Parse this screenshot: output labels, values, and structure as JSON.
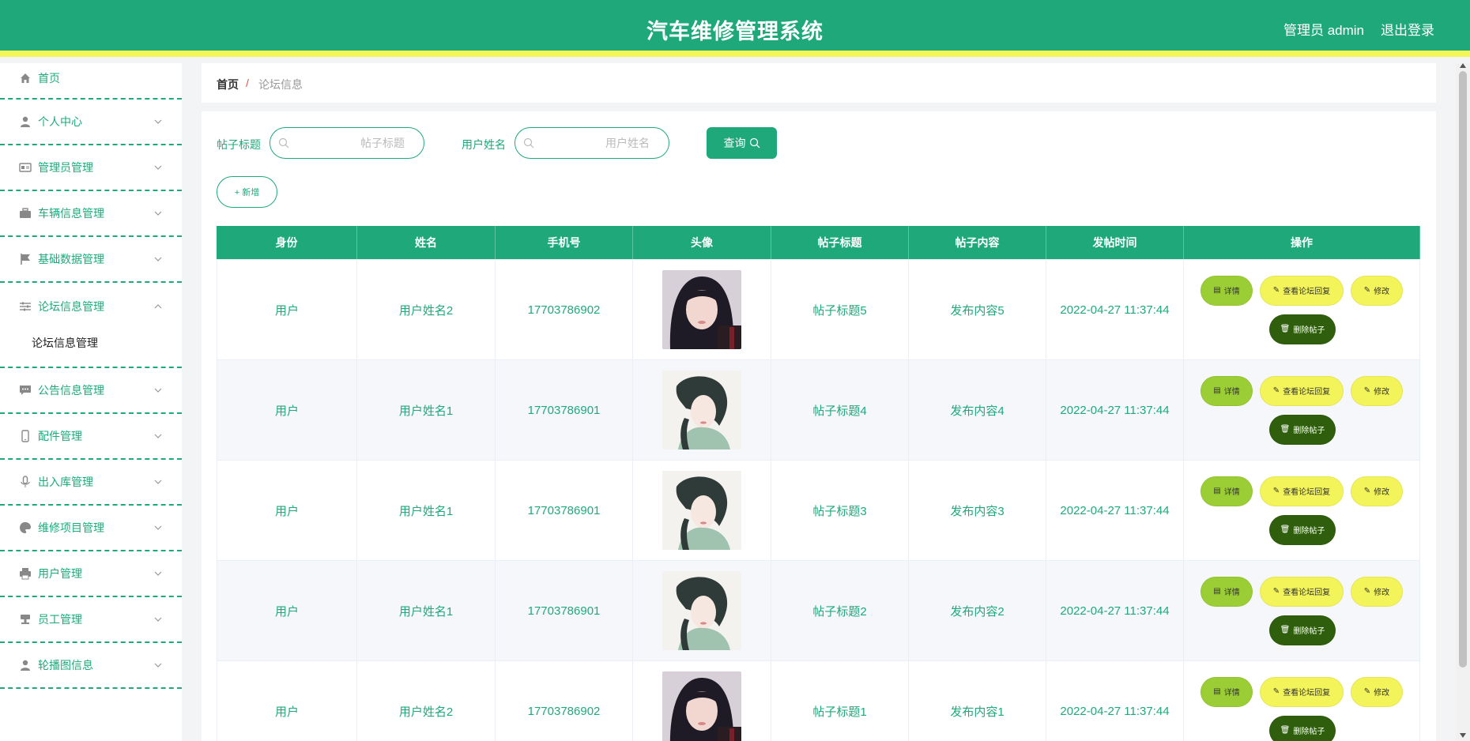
{
  "header": {
    "title": "汽车维修管理系统",
    "user": "管理员 admin",
    "logout": "退出登录"
  },
  "sidebar": {
    "items": [
      {
        "label": "首页",
        "icon": "home-icon"
      },
      {
        "label": "个人中心",
        "icon": "user-icon"
      },
      {
        "label": "管理员管理",
        "icon": "id-card-icon"
      },
      {
        "label": "车辆信息管理",
        "icon": "briefcase-icon"
      },
      {
        "label": "基础数据管理",
        "icon": "flag-icon"
      },
      {
        "label": "论坛信息管理",
        "icon": "sliders-icon",
        "sub": "论坛信息管理"
      },
      {
        "label": "公告信息管理",
        "icon": "chat-icon"
      },
      {
        "label": "配件管理",
        "icon": "phone-icon"
      },
      {
        "label": "出入库管理",
        "icon": "mic-icon"
      },
      {
        "label": "维修项目管理",
        "icon": "palette-icon"
      },
      {
        "label": "用户管理",
        "icon": "printer-icon"
      },
      {
        "label": "员工管理",
        "icon": "stamp-icon"
      },
      {
        "label": "轮播图信息",
        "icon": "user-icon"
      }
    ]
  },
  "breadcrumb": {
    "home": "首页",
    "separator": "/",
    "current": "论坛信息"
  },
  "search": {
    "title_label": "帖子标题",
    "title_placeholder": "帖子标题",
    "name_label": "用户姓名",
    "name_placeholder": "用户姓名",
    "query_label": "查询",
    "add_label": "+ 新增"
  },
  "table": {
    "headers": [
      "身份",
      "姓名",
      "手机号",
      "头像",
      "帖子标题",
      "帖子内容",
      "发帖时间",
      "操作"
    ],
    "rows": [
      {
        "role": "用户",
        "name": "用户姓名2",
        "phone": "17703786902",
        "avatar": "dark",
        "title": "帖子标题5",
        "content": "发布内容5",
        "time": "2022-04-27 11:37:44"
      },
      {
        "role": "用户",
        "name": "用户姓名1",
        "phone": "17703786901",
        "avatar": "light",
        "title": "帖子标题4",
        "content": "发布内容4",
        "time": "2022-04-27 11:37:44"
      },
      {
        "role": "用户",
        "name": "用户姓名1",
        "phone": "17703786901",
        "avatar": "light",
        "title": "帖子标题3",
        "content": "发布内容3",
        "time": "2022-04-27 11:37:44"
      },
      {
        "role": "用户",
        "name": "用户姓名1",
        "phone": "17703786901",
        "avatar": "light",
        "title": "帖子标题2",
        "content": "发布内容2",
        "time": "2022-04-27 11:37:44"
      },
      {
        "role": "用户",
        "name": "用户姓名2",
        "phone": "17703786902",
        "avatar": "dark",
        "title": "帖子标题1",
        "content": "发布内容1",
        "time": "2022-04-27 11:37:44"
      }
    ],
    "actions": {
      "detail": "详情",
      "reply": "查看论坛回复",
      "edit": "修改",
      "delete": "删除帖子"
    }
  },
  "colors": {
    "primary": "#1fa97a",
    "accent_yellow": "#f4f556",
    "detail_green": "#9bce35",
    "delete_dark": "#2f5f0c"
  }
}
